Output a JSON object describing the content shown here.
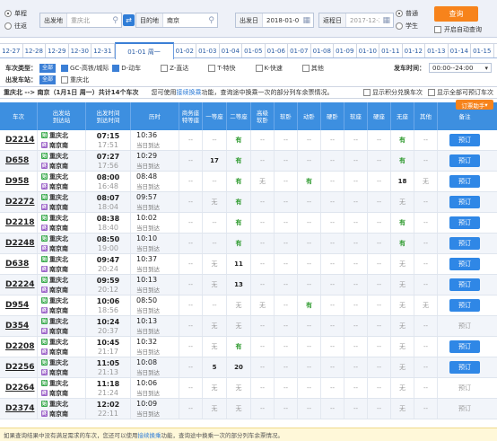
{
  "query": {
    "trip_oneway": "单程",
    "trip_round": "往返",
    "from_label": "出发地",
    "from_value": "重庆北",
    "to_label": "目的地",
    "to_value": "南京",
    "date_label": "出发日",
    "date_value": "2018-01-01",
    "return_label": "返程日",
    "return_value": "2017-12-27",
    "type_normal": "普通",
    "type_student": "学生",
    "search_button": "查询",
    "auto_query": "开启自动查询"
  },
  "dates": [
    "12-27",
    "12-28",
    "12-29",
    "12-30",
    "12-31",
    "01-01 周一",
    "01-02",
    "01-03",
    "01-04",
    "01-05",
    "01-06",
    "01-07",
    "01-08",
    "01-09",
    "01-10",
    "01-11",
    "01-12",
    "01-13",
    "01-14",
    "01-15"
  ],
  "filters": {
    "type_label": "车次类型：",
    "all_tag": "全部",
    "types": [
      "GC-高铁/城际",
      "D-动车",
      "Z-直达",
      "T-特快",
      "K-快速",
      "其他"
    ],
    "station_label": "出发车站：",
    "station": "重庆北",
    "time_label": "发车时间：",
    "time_value": "00:00--24:00"
  },
  "bar": {
    "route": "重庆北 --> 南京（1月1日 周一）共计14个车次",
    "tip_prefix": "您可使用",
    "tip_link": "接续换乘",
    "tip_suffix": "功能，查询途中换乘一次的部分列车余票情况。",
    "points_check": "显示积分兑换车次",
    "all_check": "显示全部可预订车次",
    "dropdown": "订票助手"
  },
  "headers": {
    "train": "车次",
    "station_from": "出发站",
    "station_to": "到达站",
    "time_dep": "出发时间",
    "time_arr": "到达时间",
    "duration": "历时",
    "business": [
      "商务座",
      "特等座"
    ],
    "first": "一等座",
    "second": "二等座",
    "high_soft": [
      "高级",
      "软卧"
    ],
    "soft_sleeper": "软卧",
    "moving_sleeper": "动卧",
    "hard_sleeper": "硬卧",
    "soft_seat": "软座",
    "hard_seat": "硬座",
    "no_seat": "无座",
    "other": "其他",
    "note": "备注"
  },
  "trains": [
    {
      "no": "D2214",
      "from": "重庆北",
      "to": "南京南",
      "dep": "07:15",
      "arr": "17:51",
      "dur": "10:36",
      "day": "当日到达",
      "bus": "--",
      "first": "--",
      "second": "有",
      "hs": "--",
      "soft": "--",
      "move": "--",
      "hard": "--",
      "softseat": "--",
      "hardseat": "--",
      "none": "有",
      "other": "--",
      "book": "预订",
      "bookable": true
    },
    {
      "no": "D658",
      "from": "重庆北",
      "to": "南京南",
      "dep": "07:27",
      "arr": "17:56",
      "dur": "10:29",
      "day": "当日到达",
      "bus": "--",
      "first": "17",
      "second": "有",
      "hs": "--",
      "soft": "--",
      "move": "--",
      "hard": "--",
      "softseat": "--",
      "hardseat": "--",
      "none": "有",
      "other": "--",
      "book": "预订",
      "bookable": true
    },
    {
      "no": "D958",
      "from": "重庆北",
      "to": "南京南",
      "dep": "08:00",
      "arr": "16:48",
      "dur": "08:48",
      "day": "当日到达",
      "bus": "--",
      "first": "--",
      "second": "有",
      "hs": "无",
      "soft": "--",
      "move": "有",
      "hard": "--",
      "softseat": "--",
      "hardseat": "--",
      "none": "18",
      "other": "无",
      "book": "预订",
      "bookable": true
    },
    {
      "no": "D2272",
      "from": "重庆北",
      "to": "南京南",
      "dep": "08:07",
      "arr": "18:04",
      "dur": "09:57",
      "day": "当日到达",
      "bus": "--",
      "first": "无",
      "second": "有",
      "hs": "--",
      "soft": "--",
      "move": "--",
      "hard": "--",
      "softseat": "--",
      "hardseat": "--",
      "none": "无",
      "other": "--",
      "book": "预订",
      "bookable": true
    },
    {
      "no": "D2218",
      "from": "重庆北",
      "to": "南京南",
      "dep": "08:38",
      "arr": "18:40",
      "dur": "10:02",
      "day": "当日到达",
      "bus": "--",
      "first": "--",
      "second": "有",
      "hs": "--",
      "soft": "--",
      "move": "--",
      "hard": "--",
      "softseat": "--",
      "hardseat": "--",
      "none": "有",
      "other": "--",
      "book": "预订",
      "bookable": true
    },
    {
      "no": "D2248",
      "from": "重庆北",
      "to": "南京南",
      "dep": "08:50",
      "arr": "19:00",
      "dur": "10:10",
      "day": "当日到达",
      "bus": "--",
      "first": "--",
      "second": "有",
      "hs": "--",
      "soft": "--",
      "move": "--",
      "hard": "--",
      "softseat": "--",
      "hardseat": "--",
      "none": "有",
      "other": "--",
      "book": "预订",
      "bookable": true
    },
    {
      "no": "D638",
      "from": "重庆北",
      "to": "南京南",
      "dep": "09:47",
      "arr": "20:24",
      "dur": "10:37",
      "day": "当日到达",
      "bus": "--",
      "first": "无",
      "second": "11",
      "hs": "--",
      "soft": "--",
      "move": "--",
      "hard": "--",
      "softseat": "--",
      "hardseat": "--",
      "none": "无",
      "other": "--",
      "book": "预订",
      "bookable": true
    },
    {
      "no": "D2224",
      "from": "重庆北",
      "to": "南京南",
      "dep": "09:59",
      "arr": "20:12",
      "dur": "10:13",
      "day": "当日到达",
      "bus": "--",
      "first": "无",
      "second": "13",
      "hs": "--",
      "soft": "--",
      "move": "--",
      "hard": "--",
      "softseat": "--",
      "hardseat": "--",
      "none": "无",
      "other": "--",
      "book": "预订",
      "bookable": true
    },
    {
      "no": "D954",
      "from": "重庆北",
      "to": "南京南",
      "dep": "10:06",
      "arr": "18:56",
      "dur": "08:50",
      "day": "当日到达",
      "bus": "--",
      "first": "--",
      "second": "无",
      "hs": "无",
      "soft": "--",
      "move": "有",
      "hard": "--",
      "softseat": "--",
      "hardseat": "--",
      "none": "无",
      "other": "无",
      "book": "预订",
      "bookable": true
    },
    {
      "no": "D354",
      "from": "重庆北",
      "to": "南京南",
      "dep": "10:24",
      "arr": "20:37",
      "dur": "10:13",
      "day": "当日到达",
      "bus": "--",
      "first": "无",
      "second": "无",
      "hs": "--",
      "soft": "--",
      "move": "--",
      "hard": "--",
      "softseat": "--",
      "hardseat": "--",
      "none": "无",
      "other": "--",
      "book": "预订",
      "bookable": false
    },
    {
      "no": "D2208",
      "from": "重庆北",
      "to": "南京南",
      "dep": "10:45",
      "arr": "21:17",
      "dur": "10:32",
      "day": "当日到达",
      "bus": "--",
      "first": "无",
      "second": "有",
      "hs": "--",
      "soft": "--",
      "move": "--",
      "hard": "--",
      "softseat": "--",
      "hardseat": "--",
      "none": "无",
      "other": "--",
      "book": "预订",
      "bookable": true
    },
    {
      "no": "D2256",
      "from": "重庆北",
      "to": "南京南",
      "dep": "11:05",
      "arr": "21:13",
      "dur": "10:08",
      "day": "当日到达",
      "bus": "--",
      "first": "5",
      "second": "20",
      "hs": "--",
      "soft": "--",
      "move": "--",
      "hard": "--",
      "softseat": "--",
      "hardseat": "--",
      "none": "无",
      "other": "--",
      "book": "预订",
      "bookable": true
    },
    {
      "no": "D2264",
      "from": "重庆北",
      "to": "南京南",
      "dep": "11:18",
      "arr": "21:24",
      "dur": "10:06",
      "day": "当日到达",
      "bus": "--",
      "first": "无",
      "second": "无",
      "hs": "--",
      "soft": "--",
      "move": "--",
      "hard": "--",
      "softseat": "--",
      "hardseat": "--",
      "none": "无",
      "other": "--",
      "book": "预订",
      "bookable": false
    },
    {
      "no": "D2374",
      "from": "重庆北",
      "to": "南京南",
      "dep": "12:02",
      "arr": "22:11",
      "dur": "10:09",
      "day": "当日到达",
      "bus": "--",
      "first": "无",
      "second": "无",
      "hs": "--",
      "soft": "--",
      "move": "--",
      "hard": "--",
      "softseat": "--",
      "hardseat": "--",
      "none": "无",
      "other": "--",
      "book": "预订",
      "bookable": false
    }
  ],
  "footer": {
    "prefix": "如果查询结果中没有满足需求的车次，您还可以使用",
    "link": "接续换乘",
    "suffix": "功能，查询途中换乘一次的部分列车余票情况。"
  }
}
